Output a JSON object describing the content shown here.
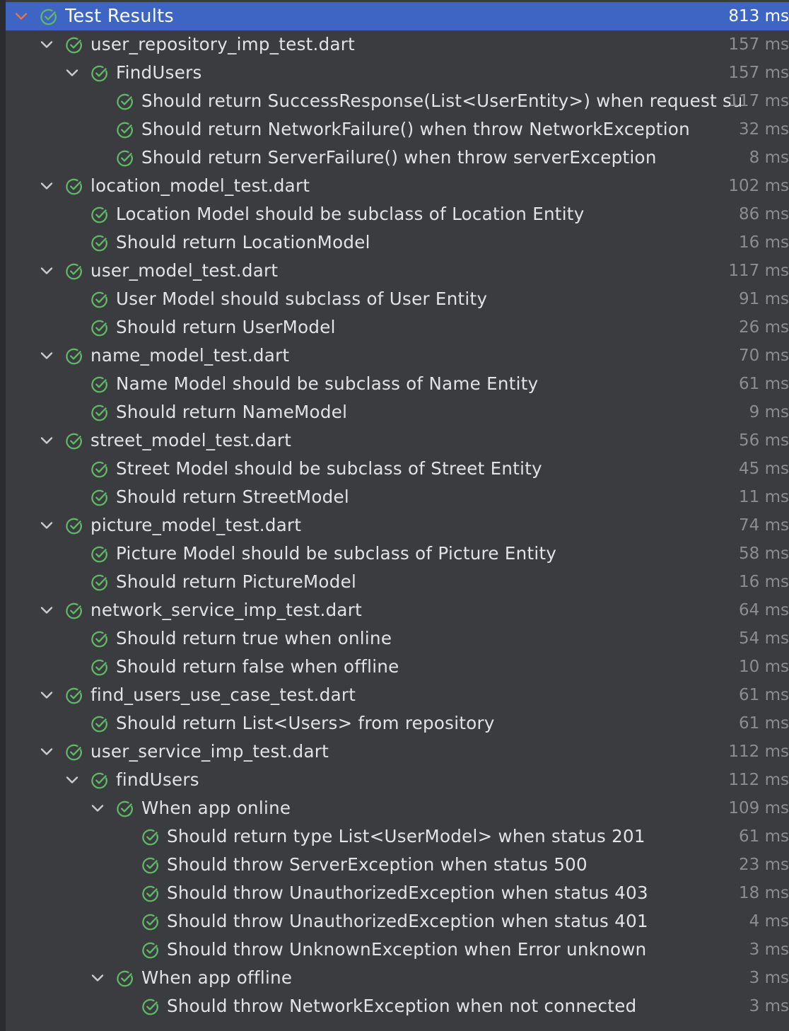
{
  "panel": {
    "title": "Test Results",
    "accent_color": "#3e65c3",
    "pass_color": "#5fb865",
    "icons": {
      "expand": "chevron-down-icon",
      "status": "check-circle-icon"
    }
  },
  "rows": [
    {
      "depth": 0,
      "expandable": true,
      "selected": true,
      "label": "Test Results",
      "time": "813 ms"
    },
    {
      "depth": 1,
      "expandable": true,
      "label": "user_repository_imp_test.dart",
      "time": "157 ms"
    },
    {
      "depth": 2,
      "expandable": true,
      "label": "FindUsers",
      "time": "157 ms"
    },
    {
      "depth": 3,
      "expandable": false,
      "label": "Should return SuccessResponse(List<UserEntity>) when request succeeds",
      "time": "117 ms"
    },
    {
      "depth": 3,
      "expandable": false,
      "label": "Should return NetworkFailure() when throw NetworkException",
      "time": "32 ms"
    },
    {
      "depth": 3,
      "expandable": false,
      "label": "Should return ServerFailure() when throw serverException",
      "time": "8 ms"
    },
    {
      "depth": 1,
      "expandable": true,
      "label": "location_model_test.dart",
      "time": "102 ms"
    },
    {
      "depth": 2,
      "expandable": false,
      "label": "Location Model should be subclass of Location Entity",
      "time": "86 ms"
    },
    {
      "depth": 2,
      "expandable": false,
      "label": "Should return LocationModel",
      "time": "16 ms"
    },
    {
      "depth": 1,
      "expandable": true,
      "label": "user_model_test.dart",
      "time": "117 ms"
    },
    {
      "depth": 2,
      "expandable": false,
      "label": "User Model should subclass of User Entity",
      "time": "91 ms"
    },
    {
      "depth": 2,
      "expandable": false,
      "label": "Should return UserModel",
      "time": "26 ms"
    },
    {
      "depth": 1,
      "expandable": true,
      "label": "name_model_test.dart",
      "time": "70 ms"
    },
    {
      "depth": 2,
      "expandable": false,
      "label": "Name Model should be subclass of Name Entity",
      "time": "61 ms"
    },
    {
      "depth": 2,
      "expandable": false,
      "label": "Should return NameModel",
      "time": "9 ms"
    },
    {
      "depth": 1,
      "expandable": true,
      "label": "street_model_test.dart",
      "time": "56 ms"
    },
    {
      "depth": 2,
      "expandable": false,
      "label": "Street Model should be subclass of Street Entity",
      "time": "45 ms"
    },
    {
      "depth": 2,
      "expandable": false,
      "label": "Should return  StreetModel",
      "time": "11 ms"
    },
    {
      "depth": 1,
      "expandable": true,
      "label": "picture_model_test.dart",
      "time": "74 ms"
    },
    {
      "depth": 2,
      "expandable": false,
      "label": "Picture Model should be subclass of Picture Entity",
      "time": "58 ms"
    },
    {
      "depth": 2,
      "expandable": false,
      "label": "Should return PictureModel",
      "time": "16 ms"
    },
    {
      "depth": 1,
      "expandable": true,
      "label": "network_service_imp_test.dart",
      "time": "64 ms"
    },
    {
      "depth": 2,
      "expandable": false,
      "label": "Should return true when online",
      "time": "54 ms"
    },
    {
      "depth": 2,
      "expandable": false,
      "label": "Should return false when offline",
      "time": "10 ms"
    },
    {
      "depth": 1,
      "expandable": true,
      "label": "find_users_use_case_test.dart",
      "time": "61 ms"
    },
    {
      "depth": 2,
      "expandable": false,
      "label": "Should return List<Users> from repository",
      "time": "61 ms"
    },
    {
      "depth": 1,
      "expandable": true,
      "label": "user_service_imp_test.dart",
      "time": "112 ms"
    },
    {
      "depth": 2,
      "expandable": true,
      "label": "findUsers",
      "time": "112 ms"
    },
    {
      "depth": 3,
      "expandable": true,
      "label": "When app online",
      "time": "109 ms"
    },
    {
      "depth": 4,
      "expandable": false,
      "label": "Should return type List<UserModel> when status 201",
      "time": "61 ms"
    },
    {
      "depth": 4,
      "expandable": false,
      "label": "Should throw ServerException when status 500",
      "time": "23 ms"
    },
    {
      "depth": 4,
      "expandable": false,
      "label": "Should throw UnauthorizedException when status 403",
      "time": "18 ms"
    },
    {
      "depth": 4,
      "expandable": false,
      "label": "Should throw UnauthorizedException when status 401",
      "time": "4 ms"
    },
    {
      "depth": 4,
      "expandable": false,
      "label": "Should throw UnknownException when Error unknown",
      "time": "3 ms"
    },
    {
      "depth": 3,
      "expandable": true,
      "label": "When app offline",
      "time": "3 ms"
    },
    {
      "depth": 4,
      "expandable": false,
      "label": "Should throw NetworkException when not connected",
      "time": "3 ms"
    }
  ]
}
